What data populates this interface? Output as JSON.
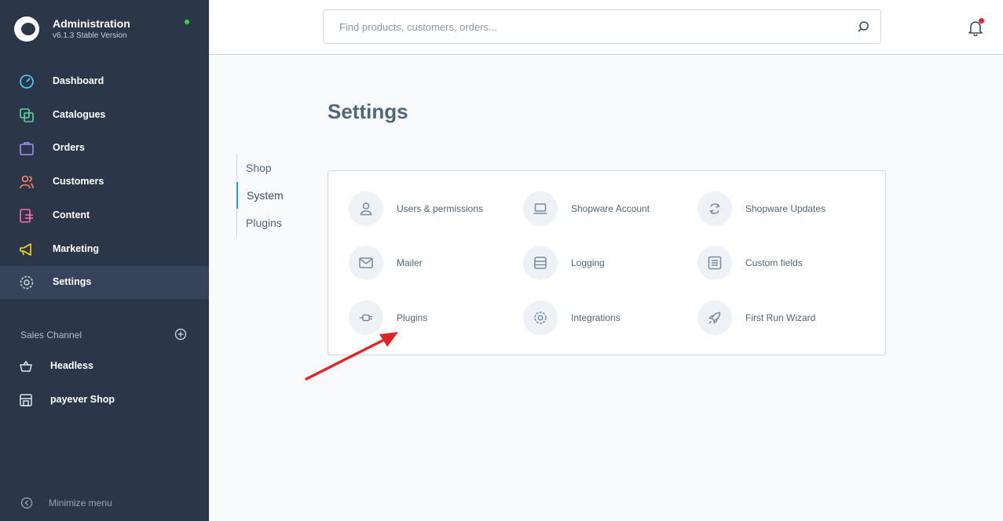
{
  "brand": {
    "title": "Administration",
    "version": "v6.1.3 Stable Version"
  },
  "nav": [
    {
      "label": "Dashboard",
      "icon": "dashboard-icon",
      "color": "#57d9a3"
    },
    {
      "label": "Catalogues",
      "icon": "catalogue-icon",
      "color": "#57d9a3"
    },
    {
      "label": "Orders",
      "icon": "orders-icon",
      "color": "#a092f0"
    },
    {
      "label": "Customers",
      "icon": "customers-icon",
      "color": "#f88962"
    },
    {
      "label": "Content",
      "icon": "content-icon",
      "color": "#ff68b4"
    },
    {
      "label": "Marketing",
      "icon": "marketing-icon",
      "color": "#ffd700"
    },
    {
      "label": "Settings",
      "icon": "settings-icon",
      "color": "#c7ced8"
    }
  ],
  "sales_channel": {
    "header": "Sales Channel",
    "items": [
      {
        "label": "Headless",
        "icon": "basket-icon"
      },
      {
        "label": "payever Shop",
        "icon": "storefront-icon"
      }
    ]
  },
  "minimize_label": "Minimize menu",
  "search": {
    "placeholder": "Find products, customers, orders..."
  },
  "page_title": "Settings",
  "tabs": [
    {
      "label": "Shop",
      "active": false
    },
    {
      "label": "System",
      "active": true
    },
    {
      "label": "Plugins",
      "active": false
    }
  ],
  "tiles": [
    {
      "label": "Users & permissions",
      "icon": "user-icon"
    },
    {
      "label": "Shopware Account",
      "icon": "laptop-icon"
    },
    {
      "label": "Shopware Updates",
      "icon": "refresh-icon"
    },
    {
      "label": "Mailer",
      "icon": "envelope-icon"
    },
    {
      "label": "Logging",
      "icon": "server-icon"
    },
    {
      "label": "Custom fields",
      "icon": "list-icon"
    },
    {
      "label": "Plugins",
      "icon": "plug-icon"
    },
    {
      "label": "Integrations",
      "icon": "gear-icon"
    },
    {
      "label": "First Run Wizard",
      "icon": "rocket-icon"
    }
  ],
  "colors": {
    "sidebar": "#2b3648",
    "accent": "#189eff",
    "annotation_arrow": "#e3252a"
  }
}
